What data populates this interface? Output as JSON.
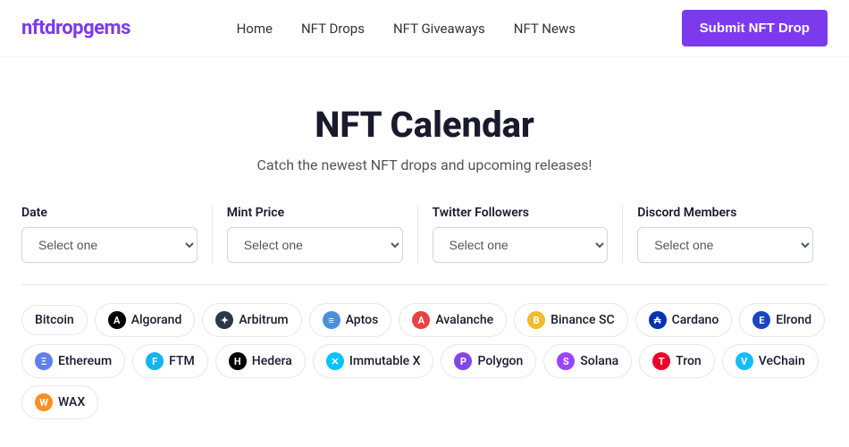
{
  "header": {
    "logo_prefix": "nftdrop",
    "logo_suffix": "gems",
    "nav_items": [
      {
        "label": "Home",
        "href": "#"
      },
      {
        "label": "NFT Drops",
        "href": "#"
      },
      {
        "label": "NFT Giveaways",
        "href": "#"
      },
      {
        "label": "NFT News",
        "href": "#"
      }
    ],
    "submit_button": "Submit NFT Drop"
  },
  "hero": {
    "title": "NFT Calendar",
    "subtitle": "Catch the newest NFT drops and upcoming releases!"
  },
  "filters": [
    {
      "id": "date",
      "label": "Date",
      "placeholder": "Select one"
    },
    {
      "id": "mint-price",
      "label": "Mint Price",
      "placeholder": "Select one"
    },
    {
      "id": "twitter-followers",
      "label": "Twitter Followers",
      "placeholder": "Select one"
    },
    {
      "id": "discord-members",
      "label": "Discord Members",
      "placeholder": "Select one"
    }
  ],
  "blockchains": [
    {
      "name": "Bitcoin",
      "color": "#f7931a",
      "symbol": "₿",
      "active": false
    },
    {
      "name": "Algorand",
      "color": "#000000",
      "symbol": "A",
      "active": false
    },
    {
      "name": "Arbitrum",
      "color": "#2d374b",
      "symbol": "✦",
      "active": false
    },
    {
      "name": "Aptos",
      "color": "#4a90d9",
      "symbol": "≡",
      "active": false
    },
    {
      "name": "Avalanche",
      "color": "#e84142",
      "symbol": "A",
      "active": false
    },
    {
      "name": "Binance SC",
      "color": "#f3ba2f",
      "symbol": "B",
      "active": false
    },
    {
      "name": "Cardano",
      "color": "#0033ad",
      "symbol": "₳",
      "active": false
    },
    {
      "name": "Elrond",
      "color": "#1b46c2",
      "symbol": "E",
      "active": false
    },
    {
      "name": "Ethereum",
      "color": "#627eea",
      "symbol": "Ξ",
      "active": false
    },
    {
      "name": "FTM",
      "color": "#13b5ec",
      "symbol": "F",
      "active": false
    },
    {
      "name": "Hedera",
      "color": "#000000",
      "symbol": "H",
      "active": false
    },
    {
      "name": "Immutable X",
      "color": "#00c3ff",
      "symbol": "✕",
      "active": false
    },
    {
      "name": "Polygon",
      "color": "#8247e5",
      "symbol": "P",
      "active": false
    },
    {
      "name": "Solana",
      "color": "#9945ff",
      "symbol": "S",
      "active": false
    },
    {
      "name": "Tron",
      "color": "#eb0029",
      "symbol": "T",
      "active": false
    },
    {
      "name": "VeChain",
      "color": "#15bdff",
      "symbol": "V",
      "active": false
    },
    {
      "name": "WAX",
      "color": "#f89022",
      "symbol": "W",
      "active": false
    }
  ]
}
